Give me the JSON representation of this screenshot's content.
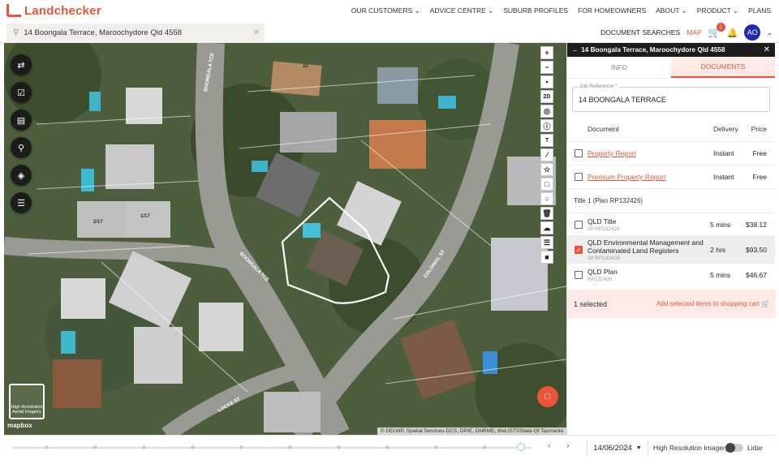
{
  "brand": {
    "name": "Landchecker"
  },
  "nav": {
    "items": [
      "OUR CUSTOMERS ⌄",
      "ADVICE CENTRE ⌄",
      "SUBURB PROFILES",
      "FOR HOMEOWNERS",
      "ABOUT ⌄",
      "PRODUCT ⌄",
      "PLANS"
    ]
  },
  "search": {
    "value": "14 Boongala Terrace, Maroochydore Qld 4558"
  },
  "toolbar": {
    "documents": "DOCUMENT SEARCHES",
    "map": "MAP",
    "cart_count": "1",
    "avatar": "AO"
  },
  "map": {
    "attribution": "© DELWP, Spatial Services-DCS, DPIE, DNRME, theLIST©State Of Tasmania",
    "hires_label": "High Resolution Aerial Imagery",
    "mapbox": "mapbox",
    "zoom_labels": [
      "+",
      "−",
      "•",
      "2D"
    ],
    "street_labels": [
      "BOONGALA TCE",
      "BOONGALA TCE",
      "COLONIAL ST",
      "LOCKE ST",
      "22",
      "2/17",
      "1/17"
    ]
  },
  "timeline": {
    "date": "14/06/2024",
    "imagery_label": "High Resolution Imagery",
    "lidar_label": "Lidar"
  },
  "panel": {
    "title": "14 Boongala Terrace, Maroochydore Qld 4558",
    "tabs": [
      "INFO",
      "DOCUMENTS"
    ],
    "job_ref_label": "Job Reference *",
    "job_ref_value": "14 BOONGALA TERRACE",
    "headers": {
      "document": "Document",
      "delivery": "Delivery",
      "price": "Price"
    },
    "rows": [
      {
        "name": "Property Report",
        "delivery": "Instant",
        "price": "Free",
        "checked": false
      },
      {
        "name": "Premium Property Report",
        "delivery": "Instant",
        "price": "Free",
        "checked": false
      }
    ],
    "section": "Title 1 (Plan RP132426)",
    "title_rows": [
      {
        "name": "QLD Title",
        "sub": "30 RP132426",
        "delivery": "5 mins",
        "price": "$38.12",
        "checked": false
      },
      {
        "name": "QLD Environmental Management and Contaminated Land Registers",
        "sub": "30 RP132426",
        "delivery": "2 hrs",
        "price": "$93.50",
        "checked": true
      },
      {
        "name": "QLD Plan",
        "sub": "RP132426",
        "delivery": "5 mins",
        "price": "$46.67",
        "checked": false
      }
    ],
    "selected_count": "1 selected",
    "add_label": "Add selected items to shopping cart"
  }
}
